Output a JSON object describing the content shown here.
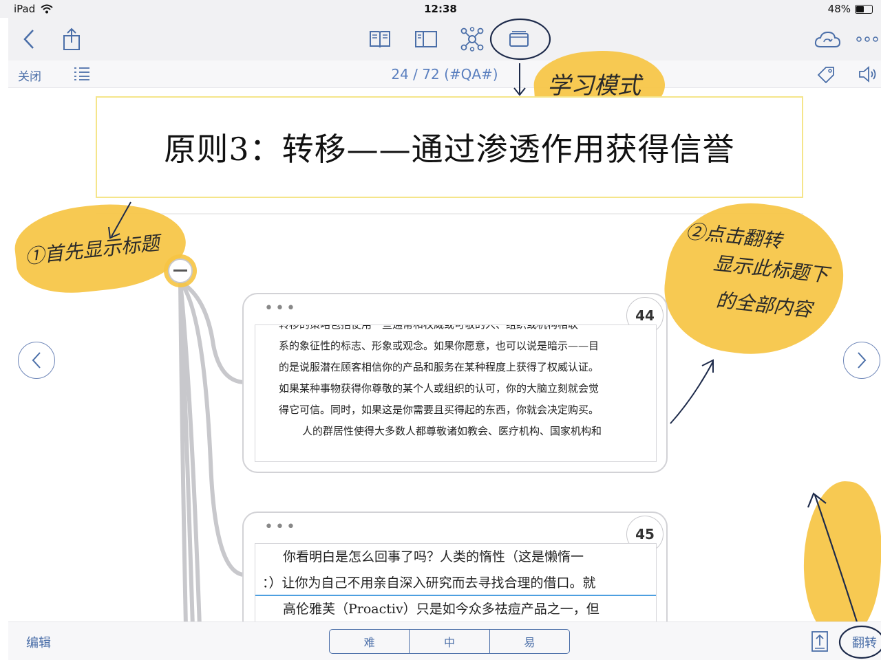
{
  "status_bar": {
    "device": "iPad",
    "time": "12:38",
    "battery": "48%",
    "battery_level": 0.48
  },
  "toolbar": {
    "buttons": [
      "back-icon",
      "share-icon",
      "book-icon",
      "sidebar-layout-icon",
      "mindmap-icon",
      "card-mode-icon",
      "cloud-sync-icon",
      "more-icon"
    ]
  },
  "subbar": {
    "close_label": "关闭",
    "page_counter": "24 / 72 (#QA#)"
  },
  "title_card": {
    "text": "原则3：转移——通过渗透作用获得信誉"
  },
  "annotations": {
    "card_mode": "学习模式",
    "note_1": "①首先显示标题",
    "note_2_line1": "②点击翻转",
    "note_2_line2": "显示此标题下",
    "note_2_line3": "的全部内容"
  },
  "cards": [
    {
      "number": "44",
      "menu": "•••",
      "lines": [
        "转移的策略包括使用一些通常和权威或可敬的人、组织或机构相联",
        "系的象征性的标志、形象或观念。如果你愿意，也可以说是暗示——目",
        "的是说服潜在顾客相信你的产品和服务在某种程度上获得了权威认证。",
        "如果某种事物获得你尊敬的某个人或组织的认可，你的大脑立刻就会觉",
        "得它可信。同时，如果这是你需要且买得起的东西，你就会决定购买。",
        "人的群居性使得大多数人都尊敬诸如教会、医疗机构、国家机构和"
      ]
    },
    {
      "number": "45",
      "menu": "•••",
      "lines": [
        "你看明白是怎么回事了吗？人类的惰性（这是懒惰一",
        "：）让你为自己不用亲自深入研究而去寻找合理的借口。就",
        "高伦雅芙（Proactiv）只是如今众多祛痘产品之一，但"
      ]
    }
  ],
  "bottom_bar": {
    "edit_label": "编辑",
    "difficulty": [
      "难",
      "中",
      "易"
    ],
    "flip_label": "翻转"
  },
  "colors": {
    "accent": "#4a6ea8",
    "highlight": "#f6c443",
    "underline": "#4d9fe0"
  }
}
